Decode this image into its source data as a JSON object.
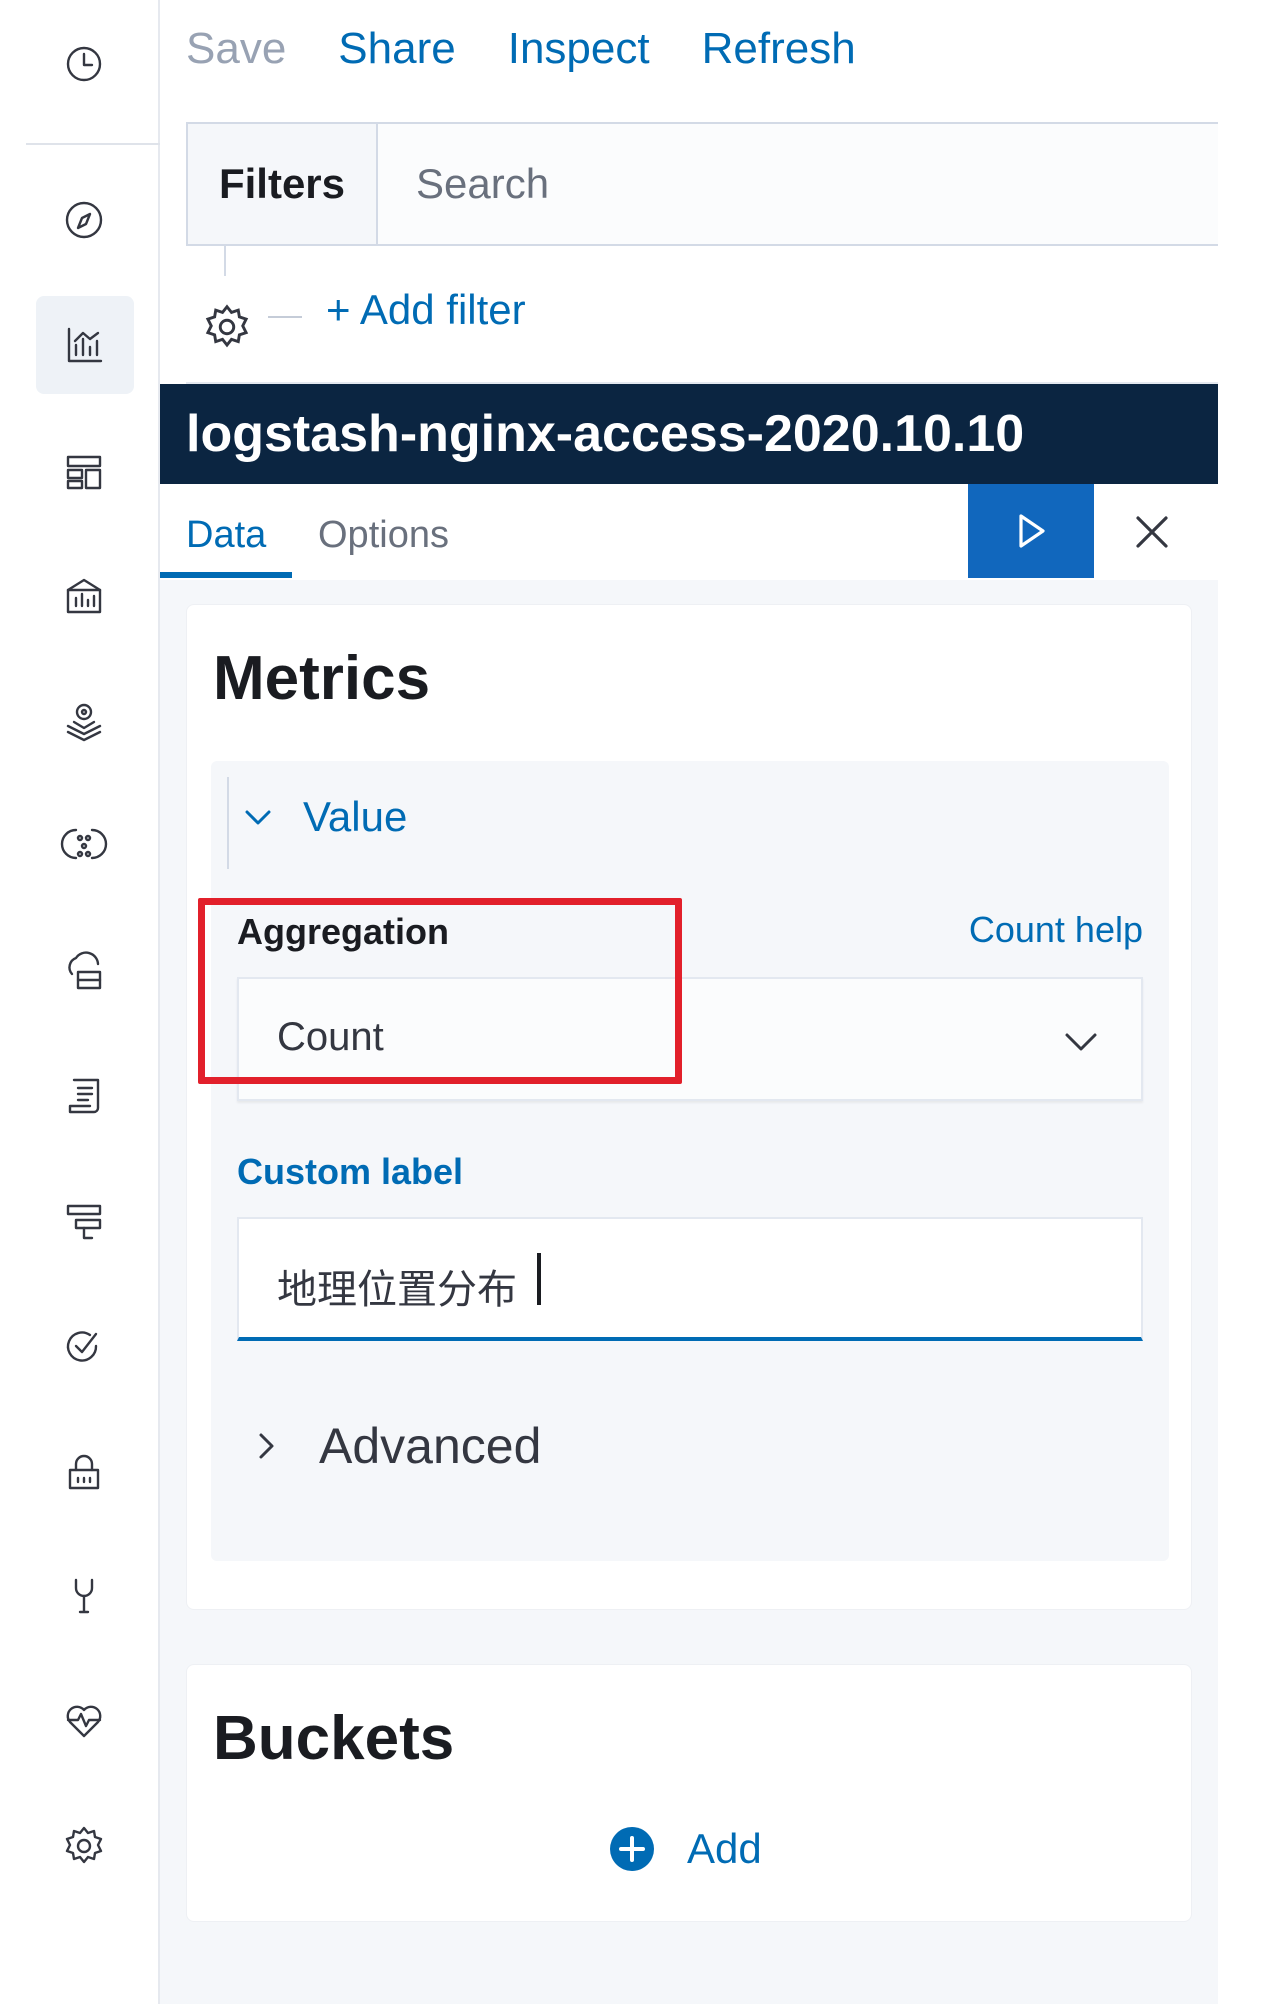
{
  "toolbar": {
    "save": "Save",
    "share": "Share",
    "inspect": "Inspect",
    "refresh": "Refresh"
  },
  "filterbar": {
    "filters_label": "Filters",
    "search_placeholder": "Search",
    "add_filter": "+ Add filter"
  },
  "index_pattern": "logstash-nginx-access-2020.10.10",
  "tabs": {
    "data": "Data",
    "options": "Options",
    "active": "Data"
  },
  "metrics": {
    "title": "Metrics",
    "metric_name": "Value",
    "aggregation_label": "Aggregation",
    "aggregation_help": "Count help",
    "aggregation_value": "Count",
    "custom_label_label": "Custom label",
    "custom_label_value": "地理位置分布",
    "advanced": "Advanced"
  },
  "buckets": {
    "title": "Buckets",
    "add": "Add"
  },
  "colors": {
    "accent": "#006bb4",
    "header_bg": "#0b2541",
    "apply_button": "#1167bd",
    "highlight": "#e2202b"
  },
  "rail_icons": [
    "clock-icon",
    "discover-compass-icon",
    "visualize-chart-icon",
    "dashboard-icon",
    "canvas-icon",
    "maps-icon",
    "ml-icon",
    "infrastructure-icon",
    "logs-icon",
    "apm-icon",
    "uptime-icon",
    "siem-lock-icon",
    "dev-tools-icon",
    "monitoring-heartbeat-icon",
    "management-gear-icon"
  ]
}
